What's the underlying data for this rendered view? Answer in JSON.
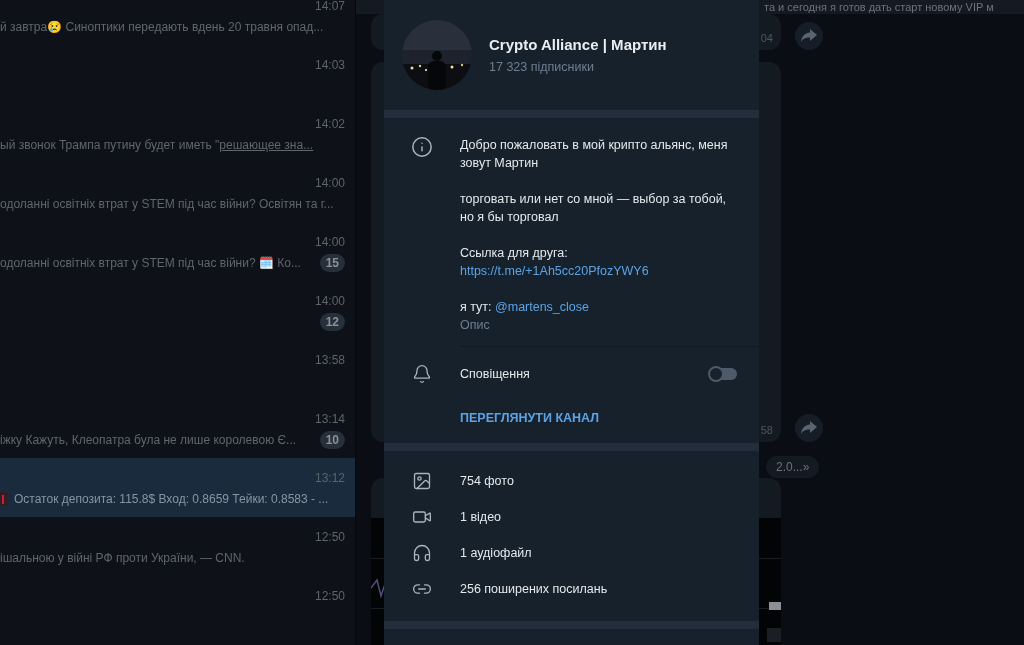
{
  "chat_list": {
    "items": [
      {
        "time": "14:07",
        "preview": "й завтра😢  Синоптики передають вдень 20 травня опад...",
        "selected": false,
        "kind": "text"
      },
      {
        "time": "14:03",
        "selected": false,
        "kind": "text"
      },
      {
        "time": "14:02",
        "preview": "ый звонок Трампа путину будет иметь \"",
        "link": "решающее зна...",
        "selected": false,
        "kind": "text"
      },
      {
        "time": "14:00",
        "preview": "одоланні освітніх втрат у STEM під час війни?  Освітян та г...",
        "selected": false,
        "kind": "text"
      },
      {
        "time": "14:00",
        "preview": "одоланні освітніх втрат у STEM під час війни? 🗓️ Ко...",
        "badge": "15",
        "selected": false,
        "kind": "text"
      },
      {
        "time": "14:00",
        "badge": "12",
        "selected": false,
        "kind": "text"
      },
      {
        "time": "13:58",
        "selected": false,
        "kind": "text"
      },
      {
        "time": "13:14",
        "preview": "іжку Кажуть, Клеопатра була не лише королевою Є...",
        "badge": "10",
        "selected": false,
        "kind": "text"
      },
      {
        "time": "13:12",
        "preview": "Остаток депозита: 115.8$  Вход: 0.8659  Тейки: 0.8583 - ...",
        "selected": true,
        "kind": "chart"
      },
      {
        "time": "12:50",
        "preview": "ішальною у війні РФ проти України, — CNN.",
        "selected": false,
        "kind": "text"
      },
      {
        "time": "12:50",
        "selected": false,
        "kind": "text"
      }
    ]
  },
  "chat": {
    "pinned": "та и сегодня я готов дать старт новому VIP м",
    "bubbles": [
      {
        "time": "04",
        "kind": "text"
      },
      {
        "time": "58",
        "kind": "text"
      },
      {
        "kind": "picture"
      }
    ],
    "service_pill": "2.0...»"
  },
  "channel_info": {
    "title": "Crypto Alliance | Мартин",
    "subscribers": "17 323 підписники",
    "description": [
      {
        "text": "Добро пожаловать в мой крипто альянс, меня зовут Мартин"
      },
      {
        "text": "торговать или нет со мной — выбор за тобой, но я бы торговал"
      },
      {
        "text": "Ссылка для друга:",
        "link": "https://t.me/+1Ah5cc20PfozYWY6",
        "kind": "link-below"
      },
      {
        "text": "я тут: ",
        "link": "@martens_close",
        "kind": "link-inline"
      }
    ],
    "description_label": "Опис",
    "notifications": {
      "label": "Сповіщення",
      "on": false
    },
    "view_channel": "ПЕРЕГЛЯНУТИ КАНАЛ",
    "media": [
      {
        "label": "754 фото"
      },
      {
        "kind": "video",
        "label": "1 відео"
      },
      {
        "kind": "audio",
        "label": "1 аудіофайл"
      },
      {
        "kind": "link",
        "label": "256 поширених посилань"
      }
    ]
  }
}
